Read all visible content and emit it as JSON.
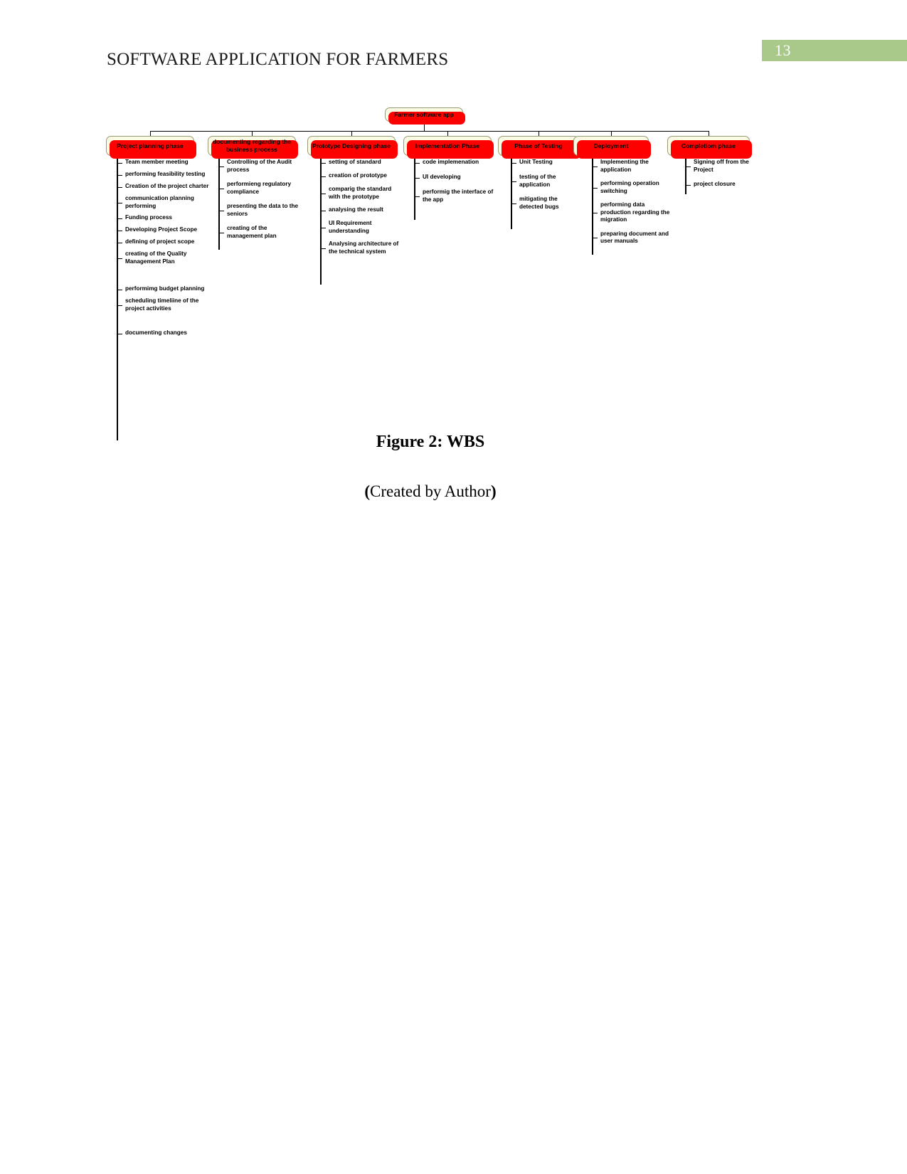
{
  "page": {
    "number": "13",
    "badge_color": "#a8c98a",
    "title": "SOFTWARE APPLICATION FOR FARMERS"
  },
  "figure": {
    "caption": "Figure 2: WBS",
    "credit_open": "(",
    "credit_text": "Created by Author",
    "credit_close": ")"
  },
  "wbs": {
    "node_fill": "#fbfbe4",
    "node_shadow": "#ff0000",
    "root": {
      "label": "Farmer software app"
    },
    "columns": [
      {
        "label": "Project planning phase",
        "tasks": [
          "Team member meeting",
          "performing feasibility testing",
          "Creation of the project charter",
          "communication planning performing",
          "Funding process",
          "Developing Project Scope",
          "defining of project scope",
          "creating of the Quality Management Plan",
          "performimg budget planning",
          "scheduling timeliine of the project activities",
          "documenting changes"
        ]
      },
      {
        "label": "documenting regarding the business process",
        "tasks": [
          "Controlling of the Audit process",
          "performieng regulatory compliance",
          "presenting the data to the seniors",
          "creating of the management plan"
        ]
      },
      {
        "label": "Prototype Designing phase",
        "tasks": [
          "setting of standard",
          "creation of prototype",
          "comparig the standard with the prototype",
          "analysing the result",
          "UI Requirement understanding",
          "Analysing architecture of the technical system"
        ]
      },
      {
        "label": "Implementation Phase",
        "tasks": [
          "code implemenation",
          "UI developing",
          "performig the interface of the app"
        ]
      },
      {
        "label": "Phase of Testing",
        "tasks": [
          "Unit Testing",
          "testing of the application",
          "mitigating the detected bugs"
        ]
      },
      {
        "label": "Deployment",
        "tasks": [
          "Implementing the application",
          "performing operation switching",
          "performing data production regarding the migration",
          "preparing document and user manuals"
        ]
      },
      {
        "label": "Completiom phase",
        "tasks": [
          "Signing off from the Project",
          "project closure"
        ]
      }
    ]
  }
}
